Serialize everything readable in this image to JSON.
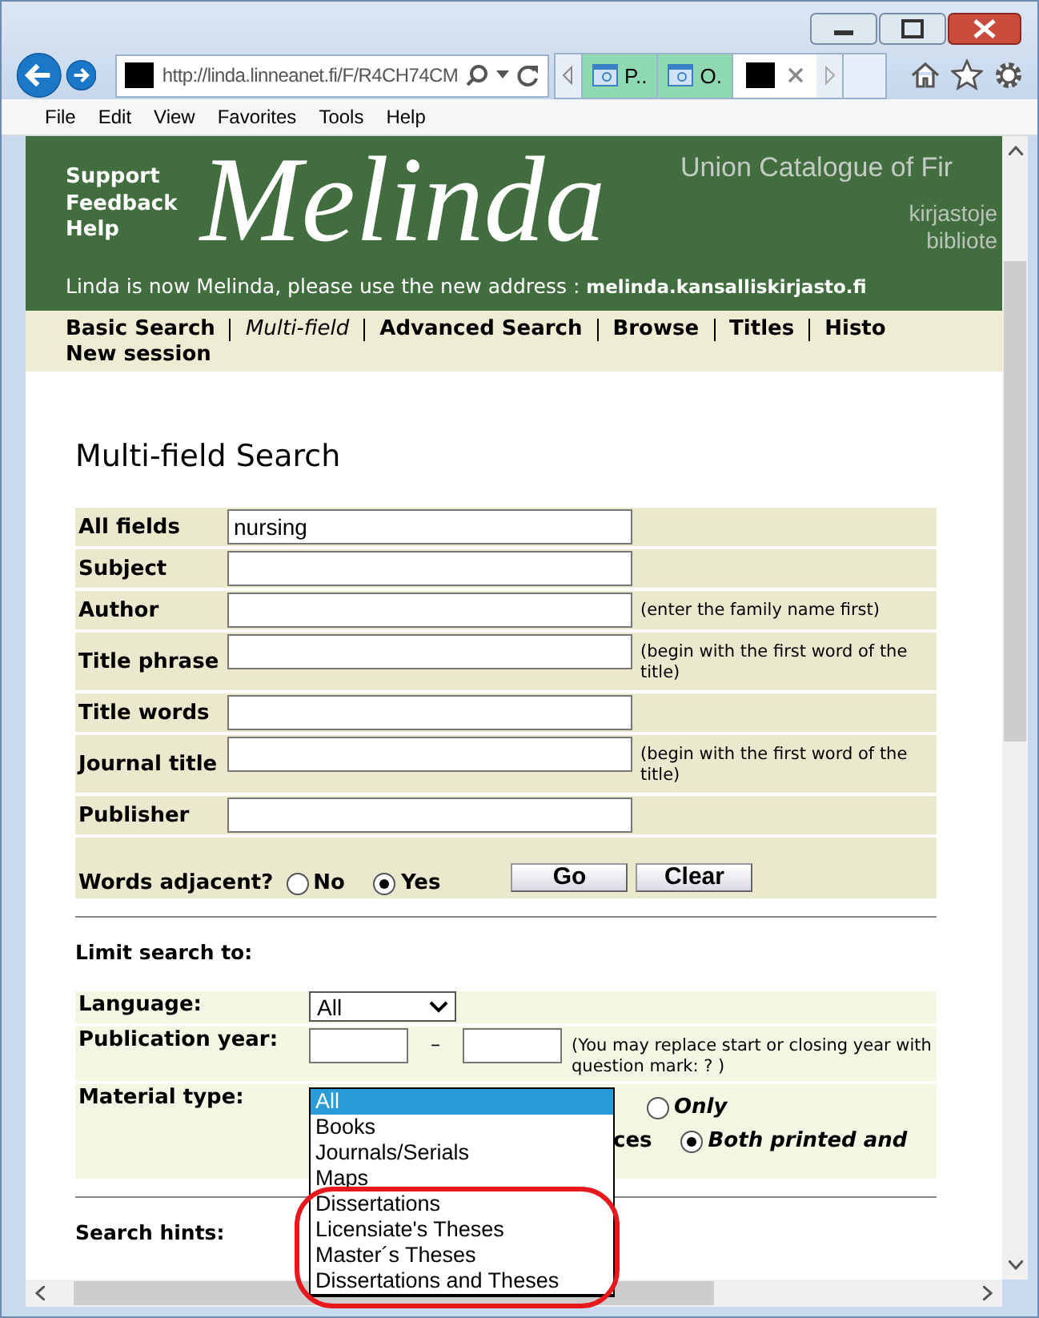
{
  "browser": {
    "address": "http://linda.linneanet.fi/F/R4CH74CM",
    "tabs": [
      {
        "label": "P..",
        "selected": false
      },
      {
        "label": "O.",
        "selected": false
      },
      {
        "selected": true
      }
    ]
  },
  "menu": [
    "File",
    "Edit",
    "View",
    "Favorites",
    "Tools",
    "Help"
  ],
  "header": {
    "links": [
      "Support",
      "Feedback",
      "Help"
    ],
    "logo": "Melinda",
    "tagline": "Union Catalogue of Fir",
    "subtitle": [
      "kirjastoje",
      "bibliote"
    ],
    "notice": "Linda is now Melinda, please use the new address : **melinda.kansalliskirjasto.fi**"
  },
  "nav": [
    {
      "label": "Basic Search",
      "selected": false
    },
    {
      "label": "Multi-field",
      "selected": true
    },
    {
      "label": "Advanced Search",
      "selected": false
    },
    {
      "label": "Browse",
      "selected": false
    },
    {
      "label": "Titles",
      "selected": false
    },
    {
      "label": "Histo",
      "selected": false
    }
  ],
  "new_session": "New session",
  "page_title": "Multi-field Search",
  "fields": [
    {
      "label": "All fields",
      "value": "nursing"
    },
    {
      "label": "Subject"
    },
    {
      "label": "Author",
      "hint": "(enter the family name first)"
    },
    {
      "label": "Title phrase",
      "hint": "(begin with the first word of the title)"
    },
    {
      "label": "Title words"
    },
    {
      "label": "Journal title",
      "hint": "(begin with the first word of the title)"
    },
    {
      "label": "Publisher"
    }
  ],
  "adjacent": {
    "label": "Words adjacent?",
    "options": [
      {
        "label": "No",
        "selected": false
      },
      {
        "label": "Yes",
        "selected": true
      }
    ]
  },
  "buttons": [
    "Go",
    "Clear"
  ],
  "limit": {
    "heading": "Limit search to:",
    "language": {
      "label": "Language:",
      "value": "All"
    },
    "year": {
      "label": "Publication year:",
      "separator": "–",
      "hint": "(You may replace start or closing year with question mark: ? )"
    },
    "material": {
      "label": "Material type:",
      "fragment": "ces",
      "radios": [
        {
          "label": "Only",
          "selected": false
        },
        {
          "label": "Both printed and",
          "selected": true
        }
      ],
      "options": [
        {
          "label": "All",
          "selected": true
        },
        {
          "label": "Books",
          "selected": false
        },
        {
          "label": "Journals/Serials",
          "selected": false
        },
        {
          "label": "Maps",
          "selected": false
        },
        {
          "label": "Dissertations",
          "selected": false
        },
        {
          "label": "Licensiate's Theses",
          "selected": false
        },
        {
          "label": "Master´s Theses",
          "selected": false
        },
        {
          "label": "Dissertations and Theses",
          "selected": false
        }
      ]
    }
  },
  "hints_heading": "Search hints:"
}
